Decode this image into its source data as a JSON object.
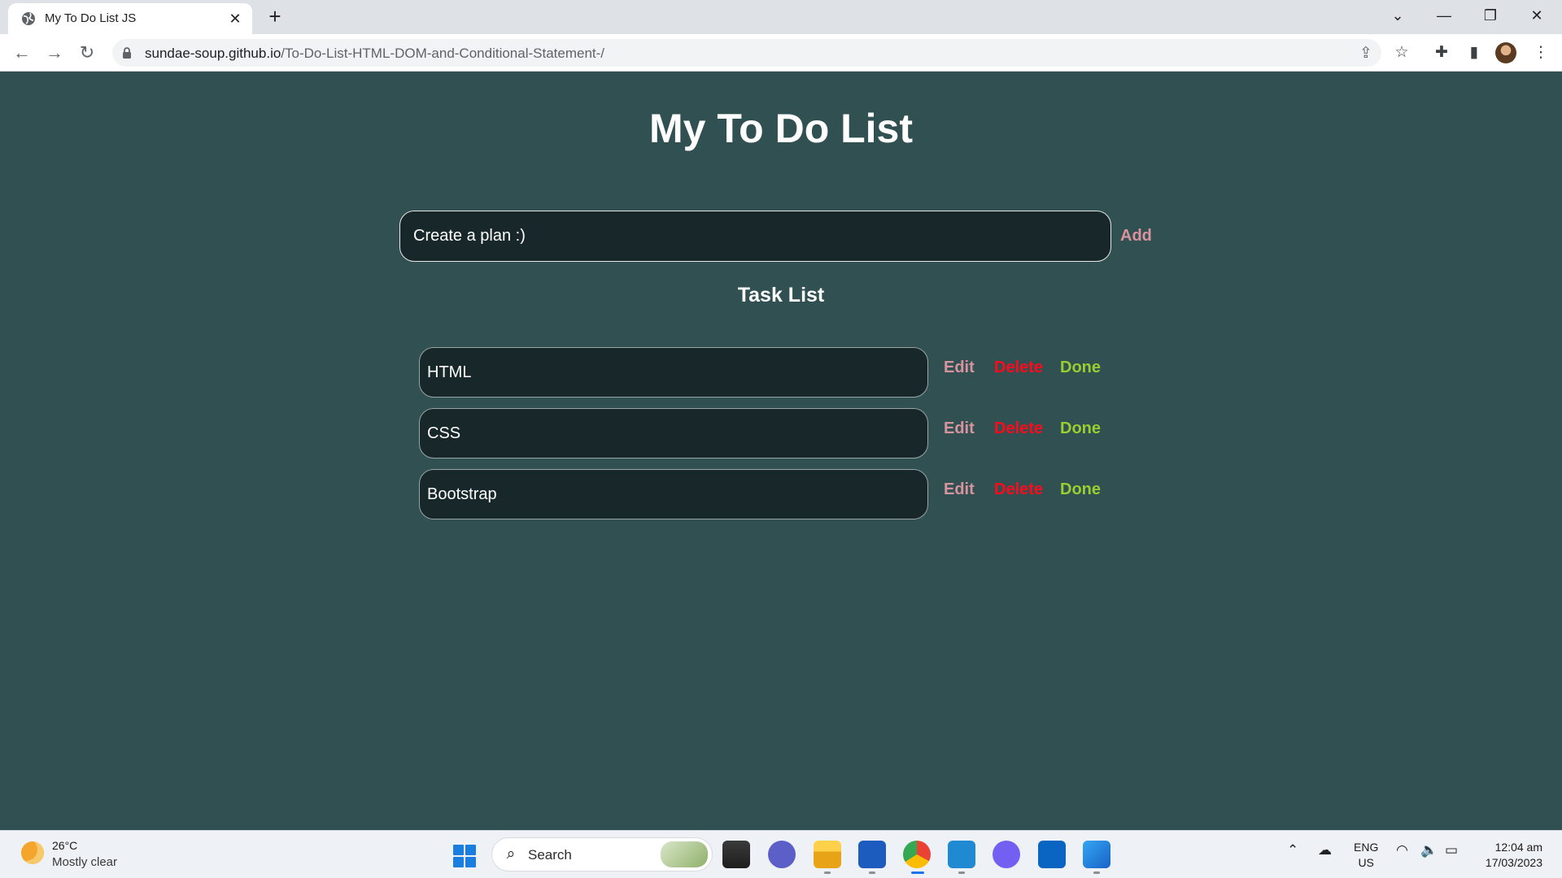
{
  "browser": {
    "tab_title": "My To Do List JS",
    "tab_close": "✕",
    "new_tab": "+",
    "url_host": "sundae-soup.github.io",
    "url_path": "/To-Do-List-HTML-DOM-and-Conditional-Statement-/",
    "icons": [
      "globe-icon",
      "back-icon",
      "forward-icon",
      "reload-icon",
      "lock-icon",
      "share-icon",
      "star-icon",
      "extensions-icon",
      "side-panel-icon",
      "avatar",
      "menu-icon",
      "tab-search-icon",
      "minimize-icon",
      "restore-icon",
      "close-icon"
    ]
  },
  "app": {
    "title": "My To Do List",
    "input_placeholder": "Create a plan :)",
    "add_label": "Add",
    "task_heading": "Task List",
    "tasks": [
      {
        "text": "HTML",
        "edit": "Edit",
        "delete": "Delete",
        "done": "Done"
      },
      {
        "text": "CSS",
        "edit": "Edit",
        "delete": "Delete",
        "done": "Done"
      },
      {
        "text": "Bootstrap",
        "edit": "Edit",
        "delete": "Delete",
        "done": "Done"
      }
    ],
    "colors": {
      "background": "#315051",
      "field": "#182729",
      "edit": "#d7939e",
      "delete": "#ff0a1c",
      "done": "#9acd32"
    }
  },
  "taskbar": {
    "weather_temp": "26°C",
    "weather_desc": "Mostly clear",
    "search_label": "Search",
    "lang_top": "ENG",
    "lang_bottom": "US",
    "time": "12:04 am",
    "date": "17/03/2023",
    "apps": [
      "file-explorer-icon",
      "teams-chat-icon",
      "folder-icon",
      "word-icon",
      "chrome-icon",
      "vscode-icon",
      "viber-icon",
      "outlook-icon",
      "photos-icon"
    ]
  }
}
